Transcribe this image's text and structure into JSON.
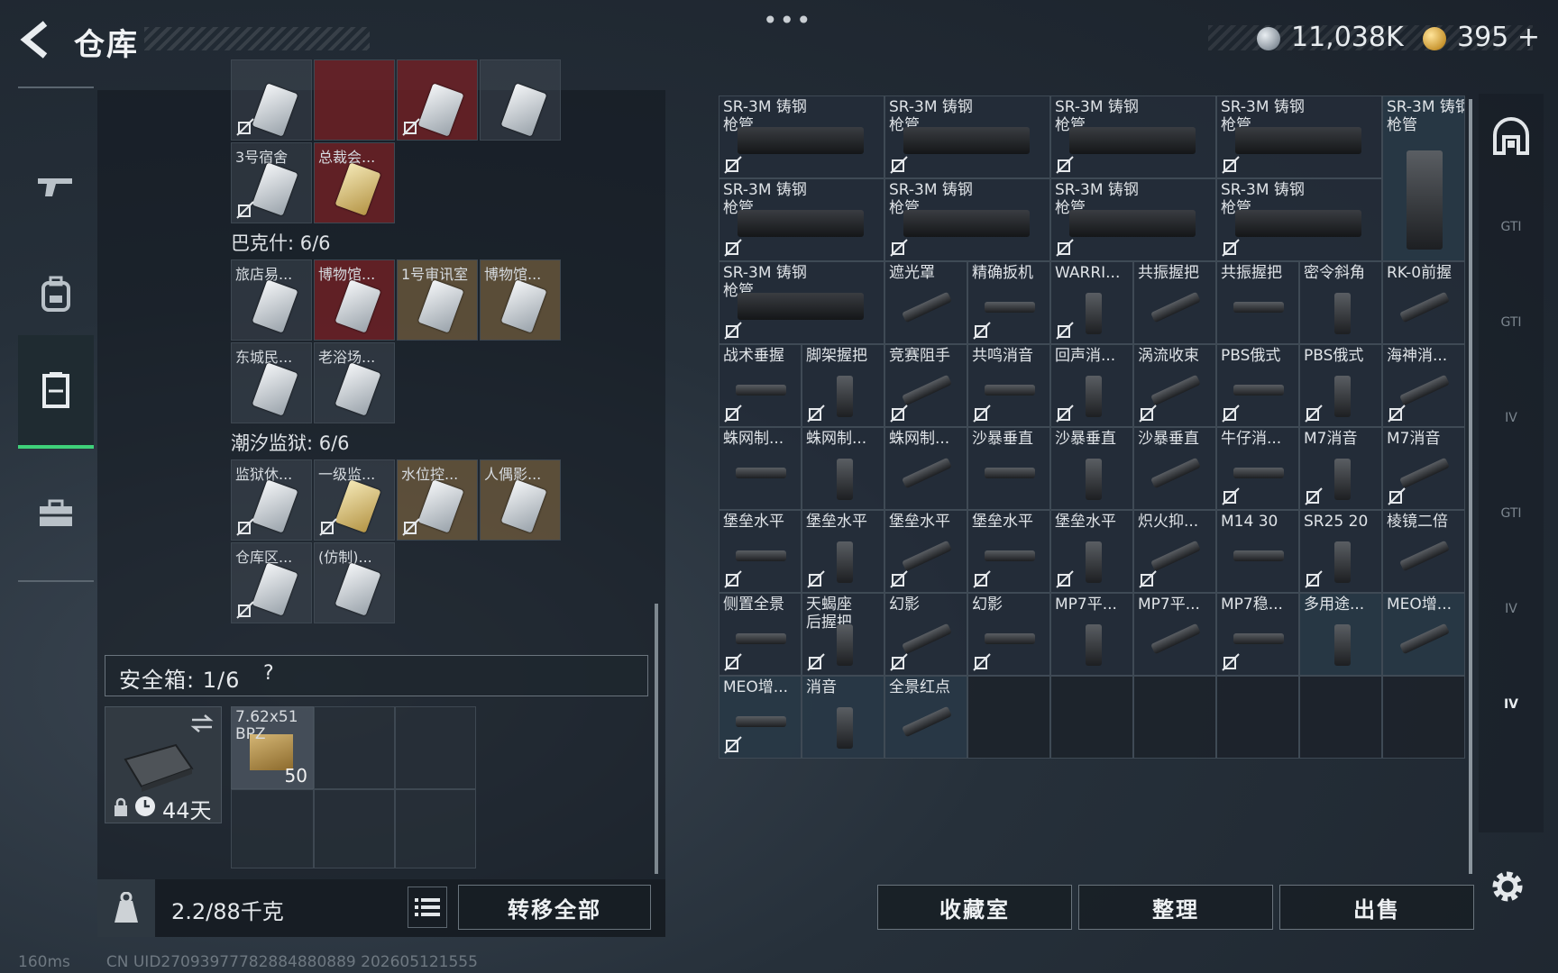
{
  "header": {
    "title": "仓库",
    "more": "•••",
    "currency1": "11,038K",
    "currency2": "395",
    "currency2_plus": "+"
  },
  "left_nav": [
    {
      "name": "weapon",
      "icon": "gun-icon"
    },
    {
      "name": "gear",
      "icon": "backpack-icon"
    },
    {
      "name": "storage",
      "icon": "locker-icon",
      "active": true
    },
    {
      "name": "case",
      "icon": "briefcase-icon"
    }
  ],
  "left_groups": {
    "top_items": [
      "3号宿舍",
      "总裁会..."
    ],
    "group1_title": "巴克什: 6/6",
    "group1_items": [
      "旅店易...",
      "博物馆...",
      "1号审讯室",
      "博物馆...",
      "东城民...",
      "老浴场..."
    ],
    "group2_title": "潮汐监狱: 6/6",
    "group2_items": [
      "监狱休...",
      "一级监...",
      "水位控...",
      "人偶影...",
      "仓库区...",
      "(仿制)..."
    ]
  },
  "safe_box": {
    "label": "安全箱: 1/6",
    "help": "?",
    "days": "44天",
    "ammo_label": "7.62x51 BPZ",
    "ammo_count": "50"
  },
  "bottom_left": {
    "weight": "2.2/88千克",
    "transfer_all": "转移全部"
  },
  "items": [
    "SR-3M 铸钢枪管",
    "SR-3M 铸钢枪管",
    "SR-3M 铸钢枪管",
    "SR-3M 铸钢枪管",
    "SR-3M 铸钢枪管",
    "SR-3M 铸钢枪管",
    "SR-3M 铸钢枪管",
    "SR-3M 铸钢枪管",
    "SR-3M 铸钢枪管",
    "SR-3M 铸钢枪管",
    "遮光罩",
    "精确扳机",
    "WARRI...",
    "共振握把",
    "共振握把",
    "密令斜角",
    "RK-0前握",
    "战术垂握",
    "脚架握把",
    "竞赛阻手",
    "共鸣消音",
    "回声消...",
    "涡流收束",
    "PBS俄式",
    "PBS俄式",
    "海神消...",
    "蛛网制...",
    "蛛网制...",
    "蛛网制...",
    "沙暴垂直",
    "沙暴垂直",
    "沙暴垂直",
    "牛仔消...",
    "M7消音",
    "M7消音",
    "堡垒水平",
    "堡垒水平",
    "堡垒水平",
    "堡垒水平",
    "堡垒水平",
    "炽火抑...",
    "M14 30",
    "SR25 20",
    "棱镜二倍",
    "侧置全景",
    "天蝎座后握把",
    "幻影",
    "幻影",
    "MP7平...",
    "MP7平...",
    "MP7稳...",
    "多用途...",
    "MEO增...",
    "MEO增...",
    "消音",
    "全景红点"
  ],
  "right_nav": [
    "GTI",
    "GTI",
    "IV",
    "GTI",
    "IV",
    "IV"
  ],
  "bottom_right": {
    "collection": "收藏室",
    "sort": "整理",
    "sell": "出售"
  },
  "status": {
    "ping": "160ms",
    "uid": "CN UID27093977782884880889 202605121555"
  }
}
